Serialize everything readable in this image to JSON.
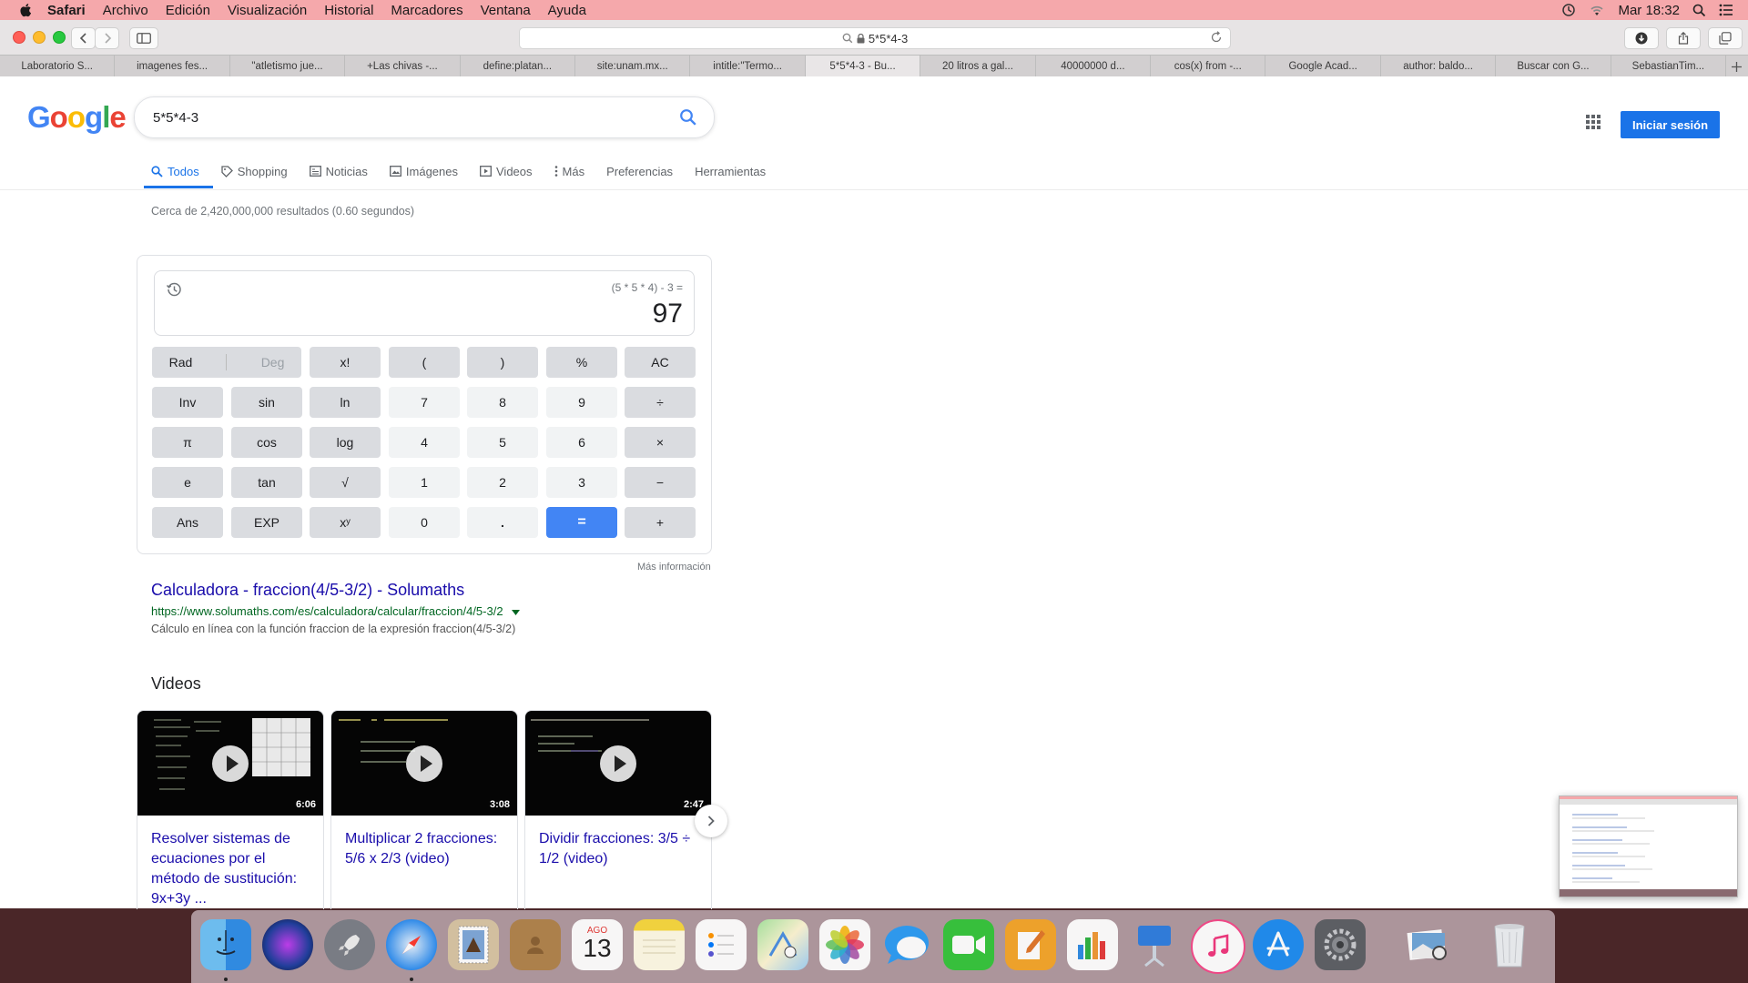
{
  "menubar": {
    "items": [
      "Safari",
      "Archivo",
      "Edición",
      "Visualización",
      "Historial",
      "Marcadores",
      "Ventana",
      "Ayuda"
    ],
    "clock": "Mar 18:32"
  },
  "browser": {
    "url": "5*5*4-3",
    "tabs": [
      "Laboratorio S...",
      "imagenes fes...",
      "\"atletismo jue...",
      "+Las chivas -...",
      "define:platan...",
      "site:unam.mx...",
      "intitle:\"Termo...",
      "5*5*4-3 - Bu...",
      "20 litros a gal...",
      "40000000 d...",
      "cos(x) from -...",
      "Google Acad...",
      "author: baldo...",
      "Buscar con G...",
      "SebastianTim..."
    ],
    "active_tab_index": 7
  },
  "google": {
    "logo": "Google",
    "query": "5*5*4-3",
    "signin": "Iniciar sesión",
    "nav": {
      "todos": "Todos",
      "shopping": "Shopping",
      "noticias": "Noticias",
      "imagenes": "Imágenes",
      "videos": "Videos",
      "mas": "Más",
      "preferencias": "Preferencias",
      "herramientas": "Herramientas"
    },
    "stats": "Cerca de 2,420,000,000 resultados (0.60 segundos)"
  },
  "calculator": {
    "expression": "(5 * 5 * 4) - 3 =",
    "result": "97",
    "rad": "Rad",
    "deg": "Deg",
    "keys": {
      "fact": "x!",
      "lparen": "(",
      "rparen": ")",
      "pct": "%",
      "ac": "AC",
      "inv": "Inv",
      "sin": "sin",
      "ln": "ln",
      "k7": "7",
      "k8": "8",
      "k9": "9",
      "div": "÷",
      "pi": "π",
      "cos": "cos",
      "log": "log",
      "k4": "4",
      "k5": "5",
      "k6": "6",
      "mul": "×",
      "e": "e",
      "tan": "tan",
      "sqrt": "√",
      "k1": "1",
      "k2": "2",
      "k3": "3",
      "minus": "−",
      "ans": "Ans",
      "exp": "EXP",
      "pow": "xʸ",
      "k0": "0",
      "dot": ".",
      "eq": "=",
      "plus": "+"
    },
    "more_info": "Más información"
  },
  "result": {
    "title": "Calculadora - fraccion(4/5-3/2) - Solumaths",
    "url": "https://www.solumaths.com/es/calculadora/calcular/fraccion/4/5-3/2",
    "description": "Cálculo en línea con la función fraccion de la expresión fraccion(4/5-3/2)"
  },
  "videos": {
    "heading": "Videos",
    "items": [
      {
        "title": "Resolver sistemas de ecuaciones por el método de sustitución: 9x+3y ...",
        "duration": "6:06"
      },
      {
        "title": "Multiplicar 2 fracciones: 5/6 x 2/3 (video)",
        "duration": "3:08"
      },
      {
        "title": "Dividir fracciones: 3/5 ÷ 1/2 (video)",
        "duration": "2:47"
      }
    ]
  },
  "dock": {
    "calendar_month": "AGO",
    "calendar_day": "13"
  },
  "colors": {
    "menubar": "#f5a8ab",
    "google_blue": "#4285f4",
    "link": "#1a0dab",
    "url_green": "#006621"
  }
}
